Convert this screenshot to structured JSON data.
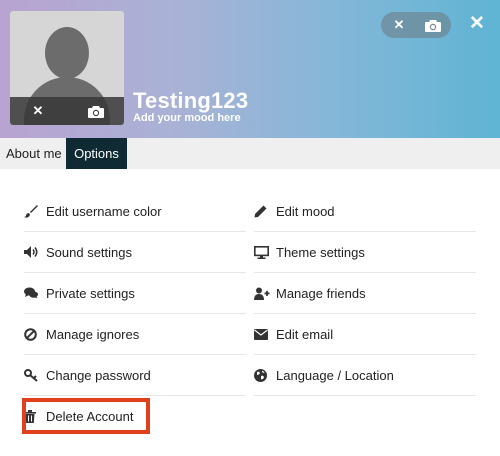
{
  "profile": {
    "username": "Testing123",
    "mood_placeholder": "Add your mood here"
  },
  "tabs": [
    {
      "label": "About me",
      "active": false
    },
    {
      "label": "Options",
      "active": true
    }
  ],
  "options": {
    "left": [
      {
        "label": "Edit username color",
        "icon": "brush-icon"
      },
      {
        "label": "Sound settings",
        "icon": "volume-icon"
      },
      {
        "label": "Private settings",
        "icon": "comments-icon"
      },
      {
        "label": "Manage ignores",
        "icon": "ban-icon"
      },
      {
        "label": "Change password",
        "icon": "key-icon"
      },
      {
        "label": "Delete Account",
        "icon": "trash-icon"
      }
    ],
    "right": [
      {
        "label": "Edit mood",
        "icon": "pencil-icon"
      },
      {
        "label": "Theme settings",
        "icon": "monitor-icon"
      },
      {
        "label": "Manage friends",
        "icon": "user-plus-icon"
      },
      {
        "label": "Edit email",
        "icon": "envelope-icon"
      },
      {
        "label": "Language / Location",
        "icon": "globe-icon"
      }
    ]
  },
  "colors": {
    "active_tab": "#0f2a33",
    "highlight": "#e0401c"
  }
}
